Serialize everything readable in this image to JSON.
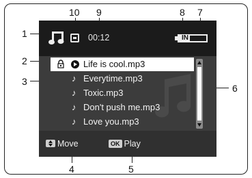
{
  "status": {
    "time": "00:12",
    "battery_label": "IN"
  },
  "playlist": {
    "items": [
      {
        "title": "Life is cool.mp3",
        "selected": true
      },
      {
        "title": "Everytime.mp3",
        "selected": false
      },
      {
        "title": "Toxic.mp3",
        "selected": false
      },
      {
        "title": "Don't push me.mp3",
        "selected": false
      },
      {
        "title": "Love you.mp3",
        "selected": false
      }
    ]
  },
  "hints": {
    "move_label": "Move",
    "ok_key": "OK",
    "play_label": "Play"
  },
  "callouts": {
    "c1": "1",
    "c2": "2",
    "c3": "3",
    "c4": "4",
    "c5": "5",
    "c6": "6",
    "c7": "7",
    "c8": "8",
    "c9": "9",
    "c10": "10"
  },
  "icons": {
    "music_mode": "music-note-icon",
    "playback": "playback-mode-icon",
    "battery": "battery-icon",
    "lock": "lock-icon",
    "play": "play-icon",
    "note": "note-icon",
    "move_key": "up-down-key-icon"
  },
  "colors": {
    "screen_bg": "#3c3c3c",
    "status_bg": "#1b1b1b",
    "bottom_bg": "#303030",
    "selection_bg": "#ffffff"
  }
}
